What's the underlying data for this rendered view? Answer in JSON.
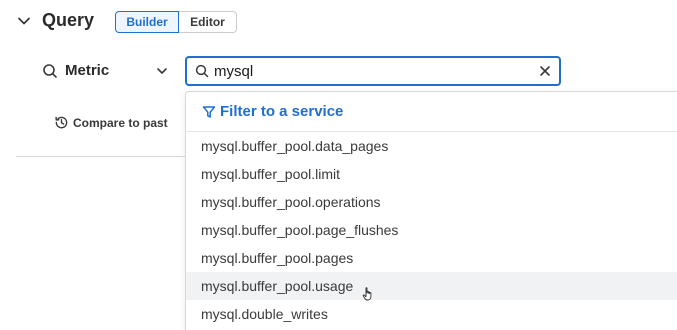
{
  "header": {
    "title": "Query",
    "modes": {
      "builder": "Builder",
      "editor": "Editor",
      "active": "builder"
    }
  },
  "metric": {
    "label": "Metric",
    "search_value": "mysql"
  },
  "compare": {
    "label": "Compare to past"
  },
  "dropdown": {
    "filter_label": "Filter to a service",
    "options": [
      "mysql.buffer_pool.data_pages",
      "mysql.buffer_pool.limit",
      "mysql.buffer_pool.operations",
      "mysql.buffer_pool.page_flushes",
      "mysql.buffer_pool.pages",
      "mysql.buffer_pool.usage",
      "mysql.double_writes"
    ],
    "hovered_index": 5
  },
  "colors": {
    "accent": "#1f6fd1",
    "hover": "#f1f2f4",
    "text": "#2b2b2b"
  }
}
